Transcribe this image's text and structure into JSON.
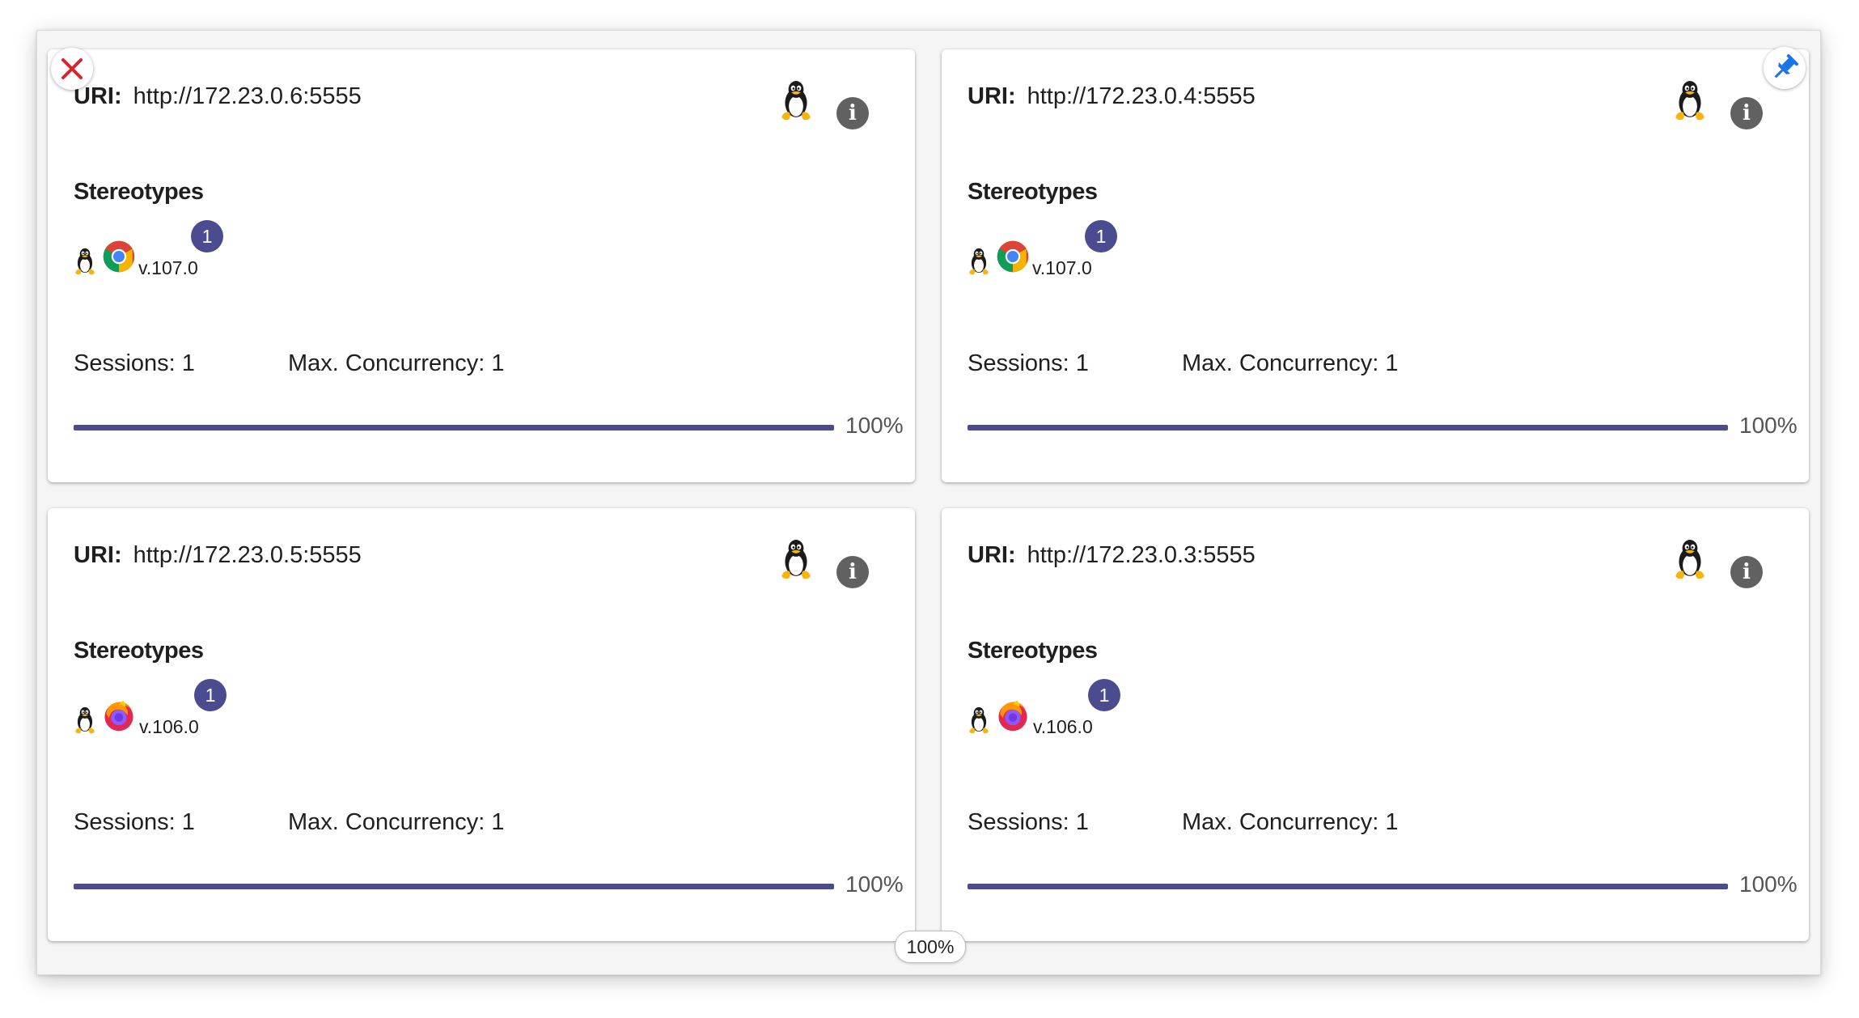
{
  "nodes": [
    {
      "uri_label": "URI:",
      "uri": "http://172.23.0.6:5555",
      "os_icon": "linux-tux-icon",
      "stereotypes_title": "Stereotypes",
      "browser": "chrome",
      "browser_icon": "chrome-icon",
      "version": "v.107.0",
      "slot_count": "1",
      "sessions": "Sessions: 1",
      "max_concurrency": "Max. Concurrency: 1",
      "load_percent": 100,
      "load_label": "100%"
    },
    {
      "uri_label": "URI:",
      "uri": "http://172.23.0.4:5555",
      "os_icon": "linux-tux-icon",
      "stereotypes_title": "Stereotypes",
      "browser": "chrome",
      "browser_icon": "chrome-icon",
      "version": "v.107.0",
      "slot_count": "1",
      "sessions": "Sessions: 1",
      "max_concurrency": "Max. Concurrency: 1",
      "load_percent": 100,
      "load_label": "100%"
    },
    {
      "uri_label": "URI:",
      "uri": "http://172.23.0.5:5555",
      "os_icon": "linux-tux-icon",
      "stereotypes_title": "Stereotypes",
      "browser": "firefox",
      "browser_icon": "firefox-icon",
      "version": "v.106.0",
      "slot_count": "1",
      "sessions": "Sessions: 1",
      "max_concurrency": "Max. Concurrency: 1",
      "load_percent": 100,
      "load_label": "100%"
    },
    {
      "uri_label": "URI:",
      "uri": "http://172.23.0.3:5555",
      "os_icon": "linux-tux-icon",
      "stereotypes_title": "Stereotypes",
      "browser": "firefox",
      "browser_icon": "firefox-icon",
      "version": "v.106.0",
      "slot_count": "1",
      "sessions": "Sessions: 1",
      "max_concurrency": "Max. Concurrency: 1",
      "load_percent": 100,
      "load_label": "100%"
    }
  ],
  "overlay": {
    "close_icon": "close-x-icon",
    "pin_icon": "pin-icon",
    "zoom_label": "100%"
  },
  "colors": {
    "accent": "#4b4b8f",
    "close_red": "#d9232e",
    "pin_blue": "#1a73e8",
    "info_gray": "#616161"
  }
}
